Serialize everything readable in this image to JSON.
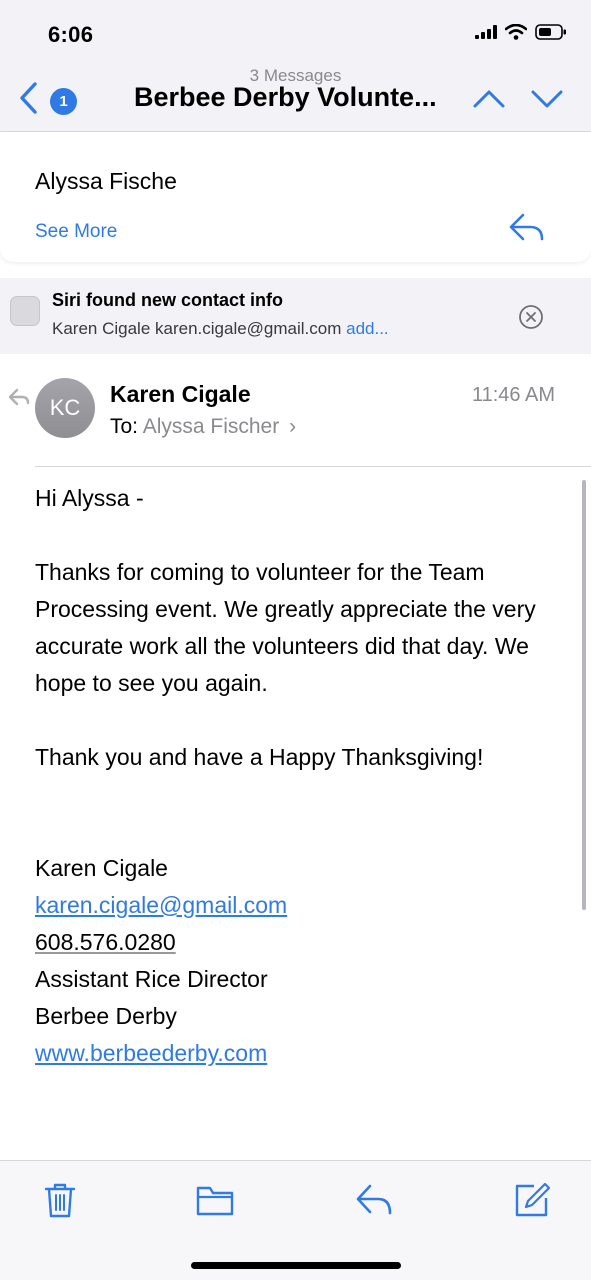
{
  "status": {
    "time": "6:06"
  },
  "nav": {
    "back_badge": "1",
    "message_count": "3 Messages",
    "title": "Berbee Derby Volunte..."
  },
  "previous_message": {
    "sender": "Alyssa Fische",
    "see_more": "See More"
  },
  "siri_suggestion": {
    "title": "Siri found new contact info",
    "contact": "Karen Cigale karen.cigale@gmail.com",
    "add_label": "add..."
  },
  "message": {
    "avatar_initials": "KC",
    "sender": "Karen Cigale",
    "time": "11:46 AM",
    "to_label": "To:",
    "to_name": "Alyssa  Fischer",
    "to_chevron": "›",
    "greeting": "Hi Alyssa -",
    "paragraph_1": "Thanks for coming to volunteer for the Team Processing event.  We greatly appreciate the very accurate work all the volunteers did that day.  We hope to see you again.",
    "paragraph_2": "Thank you and have a Happy Thanksgiving!",
    "signature": {
      "name": "Karen Cigale",
      "email": "karen.cigale@gmail.com",
      "phone": "608.576.0280",
      "title": "Assistant Rice Director",
      "org": "Berbee Derby",
      "website": "www.berbeederby.com"
    }
  },
  "colors": {
    "accent": "#2f7ae5",
    "secondary_text": "#8a8a8e",
    "bar_bg": "#f2f2f7"
  },
  "icons": [
    "signal-icon",
    "wifi-icon",
    "battery-icon",
    "back-chevron-icon",
    "chevron-up-icon",
    "chevron-down-icon",
    "reply-icon",
    "contacts-icon",
    "close-circle-icon",
    "trash-icon",
    "folder-icon",
    "compose-icon"
  ]
}
